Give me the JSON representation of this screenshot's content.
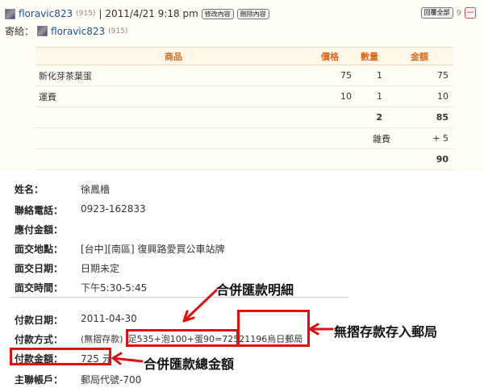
{
  "header": {
    "username": "floravic823",
    "user_count": "(915)",
    "separator": "|",
    "datetime": "2011/4/21  9:18 pm",
    "edit_label": "修改內容",
    "delete_label": "刪除內容",
    "reply_all_label": "回覆全部",
    "reply_count": "9",
    "collapse_symbol": "−"
  },
  "send_to": {
    "label": "寄給：",
    "username": "floravic823",
    "user_count": "(915)"
  },
  "order_table": {
    "headers": [
      "商品",
      "價格",
      "數量",
      "金額"
    ],
    "rows": [
      {
        "name": "新化芽茶葉蛋",
        "price": "75",
        "qty": "1",
        "amount": "75"
      },
      {
        "name": "運費",
        "price": "10",
        "qty": "1",
        "amount": "10"
      }
    ],
    "total_qty": "2",
    "subtotal": "85",
    "misc_label": "雜費",
    "misc_value": "+ 5",
    "grand_total": "90"
  },
  "info": {
    "name_label": "姓名：",
    "name_value": "徐鳳檣",
    "phone_label": "聯絡電話：",
    "phone_value": "0923-162833",
    "due_label": "應付金額：",
    "due_value": "",
    "place_label": "面交地點：",
    "place_value": "[台中][南區] 復興路愛買公車站牌",
    "date_label": "面交日期：",
    "date_value": "日期未定",
    "time_label": "面交時間：",
    "time_value": "下午5:30-5:45",
    "paydate_label": "付款日期：",
    "paydate_value": "2011-04-30",
    "method_label": "付款方式：",
    "method_prefix": "(無摺存款)",
    "method_detail": "足535+泡100+蛋90=725",
    "method_office": "21196烏日郵局",
    "amount_label": "付款金額：",
    "amount_value": "725 元",
    "account_label": "主聯帳戶：",
    "account_value": "郵局代號-700"
  },
  "annotations": {
    "combined_detail": "合併匯款明細",
    "post_office": "無摺存款存入郵局",
    "combined_total": "合併匯款總金額"
  },
  "colors": {
    "header_accent": "#d96a1a",
    "annotation_red": "#e01010",
    "username_blue": "#1f4f8f"
  }
}
